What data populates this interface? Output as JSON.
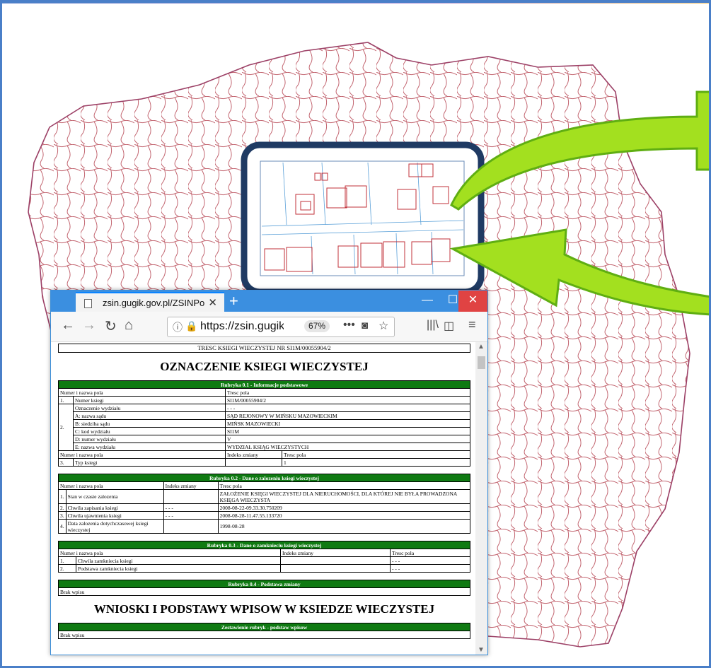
{
  "browser": {
    "tab_title": "zsin.gugik.gov.pl/ZSINPortal/Ni",
    "tab_close": "✕",
    "new_tab": "+",
    "url": "https://zsin.gugik.g",
    "zoom": "67%",
    "window_min": "—",
    "window_max": "☐",
    "window_close": "✕"
  },
  "document": {
    "header": "TRESC KSIEGI WIECZYSTEJ NR SI1M/00055904/2",
    "title": "OZNACZENIE KSIEGI WIECZYSTEJ",
    "title2": "WNIOSKI I PODSTAWY WPISOW W KSIEDZE WIECZYSTEJ",
    "brak_wpisu": "Brak wpisu",
    "s01": {
      "heading": "Rubryka 0.1 - Informacje podstawowe",
      "col_name": "Numer i nazwa pola",
      "col_content": "Tresc pola",
      "col_index": "Indeks zmiany",
      "rows": [
        {
          "no": "1.",
          "field": "Numer ksiegi",
          "value": "SI1M/00055904/2"
        },
        {
          "no": "2.",
          "field": "Oznaczenie wydziału",
          "value": "- - -"
        },
        {
          "field": "A: nazwa sądu",
          "value": "SĄD REJONOWY W MIŃSKU MAZOWIECKIM"
        },
        {
          "field": "B: siedziba sądu",
          "value": "MIŃSK MAZOWIECKI"
        },
        {
          "field": "C: kod wydziału",
          "value": "SI1M"
        },
        {
          "field": "D: numer wydziału",
          "value": "V"
        },
        {
          "field": "E: nazwa wydziału",
          "value": "WYDZIAŁ KSIĄG WIECZYSTYCH"
        },
        {
          "no": "3.",
          "field": "Typ ksiegi",
          "index": "",
          "value": "1"
        }
      ]
    },
    "s02": {
      "heading": "Rubryka 0.2 - Dane o zalozeniu ksiegi wieczystej",
      "col_name": "Numer i nazwa pola",
      "col_index": "Indeks zmiany",
      "col_content": "Tresc pola",
      "rows": [
        {
          "no": "1.",
          "field": "Stan w czasie zalozenia",
          "index": "",
          "value": "ZAŁOŻENIE KSIĘGI WIECZYSTEJ DLA NIERUCHOMOŚCI, DLA KTÓREJ NIE BYŁA PROWADZONA KSIĘGA WIECZYSTA"
        },
        {
          "no": "2.",
          "field": "Chwila zapisania ksiegi",
          "index": "- - -",
          "value": "2008-08-22-09.33.30.750209"
        },
        {
          "no": "3.",
          "field": "Chwila ujawnienia ksiegi",
          "index": "- - -",
          "value": "2008-08-28-11.47.55.133720"
        },
        {
          "no": "4.",
          "field": "Data zalozenia dotychczasowej ksiegi wieczystej",
          "index": "",
          "value": "1998-08-28"
        }
      ]
    },
    "s03": {
      "heading": "Rubryka 0.3 - Dane o zamknieciu ksiegi wieczystej",
      "col_name": "Numer i nazwa pola",
      "col_index": "Indeks zmiany",
      "col_content": "Tresc pola",
      "rows": [
        {
          "no": "1.",
          "field": "Chwila zamkniecia ksiegi",
          "index": "",
          "value": "- - -"
        },
        {
          "no": "2.",
          "field": "Podstawa zamkniecia ksiegi",
          "index": "",
          "value": "- - -"
        }
      ]
    },
    "s04": {
      "heading": "Rubryka 0.4 - Podstawa zmiany"
    },
    "zest": {
      "heading": "Zestawienie rubryk - podstaw wpisow"
    }
  },
  "colors": {
    "green_header": "#0f7a12",
    "map_border": "#b04a5a",
    "arrow": "#7fd31a",
    "tab_bar": "#3b8fe0"
  }
}
